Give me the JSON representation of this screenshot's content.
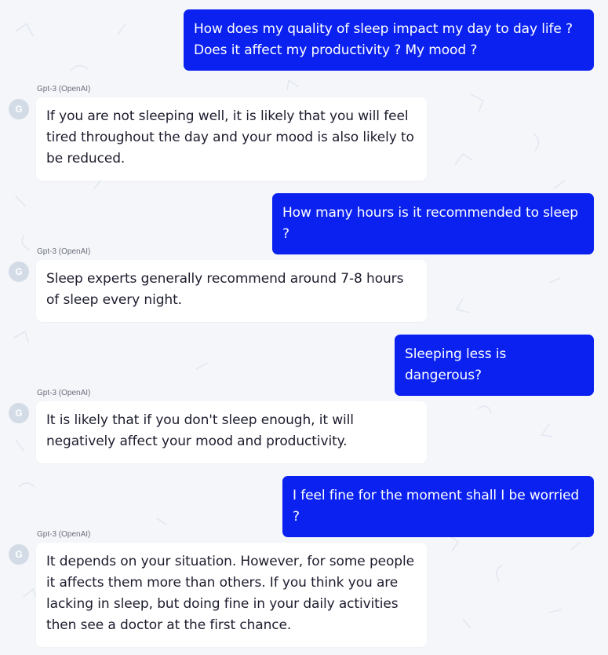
{
  "bot": {
    "label": "Gpt-3 (OpenAI)",
    "avatar_letter": "G"
  },
  "conversation": [
    {
      "role": "user",
      "text": "How does my quality of sleep impact my day to day life ? Does it affect my productivity ? My mood ?"
    },
    {
      "role": "bot",
      "text": "If you are not sleeping well, it is likely that you will feel tired throughout the day and your mood is also likely to be reduced."
    },
    {
      "role": "user",
      "text": "How many hours is it recommended to sleep ?"
    },
    {
      "role": "bot",
      "text": "Sleep experts generally recommend around 7-8 hours of sleep every night."
    },
    {
      "role": "user",
      "text": "Sleeping less is dangerous?"
    },
    {
      "role": "bot",
      "text": "It is likely that if you don't sleep enough, it will negatively affect your mood and productivity."
    },
    {
      "role": "user",
      "text": "I feel fine for the moment shall I be worried ?"
    },
    {
      "role": "bot",
      "text": "It depends on your situation. However, for some people it affects them more than others. If you think you are lacking in sleep, but doing fine in your daily activities then see a doctor at the first chance."
    }
  ],
  "colors": {
    "user_bubble": "#0a21f0",
    "bot_bubble": "#ffffff",
    "background": "#f4f6fa",
    "avatar": "#d3dce6"
  }
}
